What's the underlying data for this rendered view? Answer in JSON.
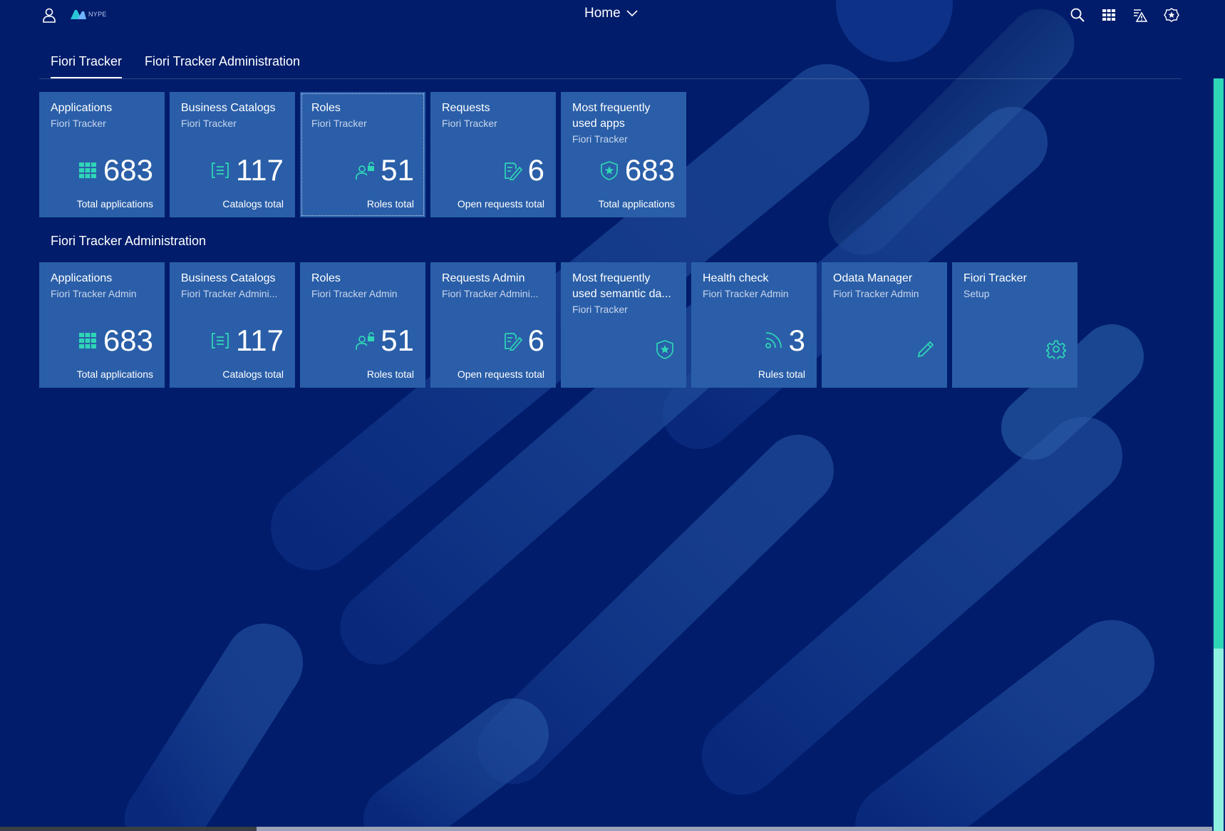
{
  "shell": {
    "logo_text": "NYPE",
    "home_label": "Home",
    "icons": [
      "user-icon",
      "search-icon",
      "app-grid-icon",
      "notifications-warning-icon",
      "support-badge-icon"
    ]
  },
  "tabs": [
    {
      "label": "Fiori Tracker",
      "active": true
    },
    {
      "label": "Fiori Tracker Administration",
      "active": false
    }
  ],
  "section_admin": {
    "title": "Fiori Tracker Administration"
  },
  "row1": [
    {
      "title": "Applications",
      "subtitle": "Fiori Tracker",
      "value": "683",
      "footer": "Total applications",
      "icon": "grid-icon"
    },
    {
      "title": "Business Catalogs",
      "subtitle": "Fiori Tracker",
      "value": "117",
      "footer": "Catalogs total",
      "icon": "catalog-icon"
    },
    {
      "title": "Roles",
      "subtitle": "Fiori Tracker",
      "value": "51",
      "footer": "Roles total",
      "icon": "user-lock-icon"
    },
    {
      "title": "Requests",
      "subtitle": "Fiori Tracker",
      "value": "6",
      "footer": "Open requests total",
      "icon": "edit-document-icon"
    },
    {
      "title": "Most frequently used apps",
      "subtitle": "Fiori Tracker",
      "value": "683",
      "footer": "Total applications",
      "icon": "badge-star-icon"
    }
  ],
  "row2": [
    {
      "title": "Applications",
      "subtitle": "Fiori Tracker Admin",
      "value": "683",
      "footer": "Total applications",
      "icon": "grid-icon"
    },
    {
      "title": "Business Catalogs",
      "subtitle": "Fiori Tracker Admini...",
      "value": "117",
      "footer": "Catalogs total",
      "icon": "catalog-icon"
    },
    {
      "title": "Roles",
      "subtitle": "Fiori Tracker Admin",
      "value": "51",
      "footer": "Roles total",
      "icon": "user-lock-icon"
    },
    {
      "title": "Requests Admin",
      "subtitle": "Fiori Tracker Admini...",
      "value": "6",
      "footer": "Open requests total",
      "icon": "edit-document-icon"
    },
    {
      "title": "Most frequently used semantic da...",
      "subtitle": "Fiori Tracker",
      "icon": "badge-star-icon"
    },
    {
      "title": "Health check",
      "subtitle": "Fiori Tracker Admin",
      "value": "3",
      "footer": "Rules total",
      "icon": "feed-icon"
    },
    {
      "title": "Odata Manager",
      "subtitle": "Fiori Tracker Admin",
      "icon": "pencil-icon"
    },
    {
      "title": "Fiori Tracker",
      "subtitle": "Setup",
      "icon": "gear-icon"
    }
  ],
  "colors": {
    "background": "#001c6b",
    "tile": "#2a5ea8",
    "accent": "#2fd6b6"
  }
}
